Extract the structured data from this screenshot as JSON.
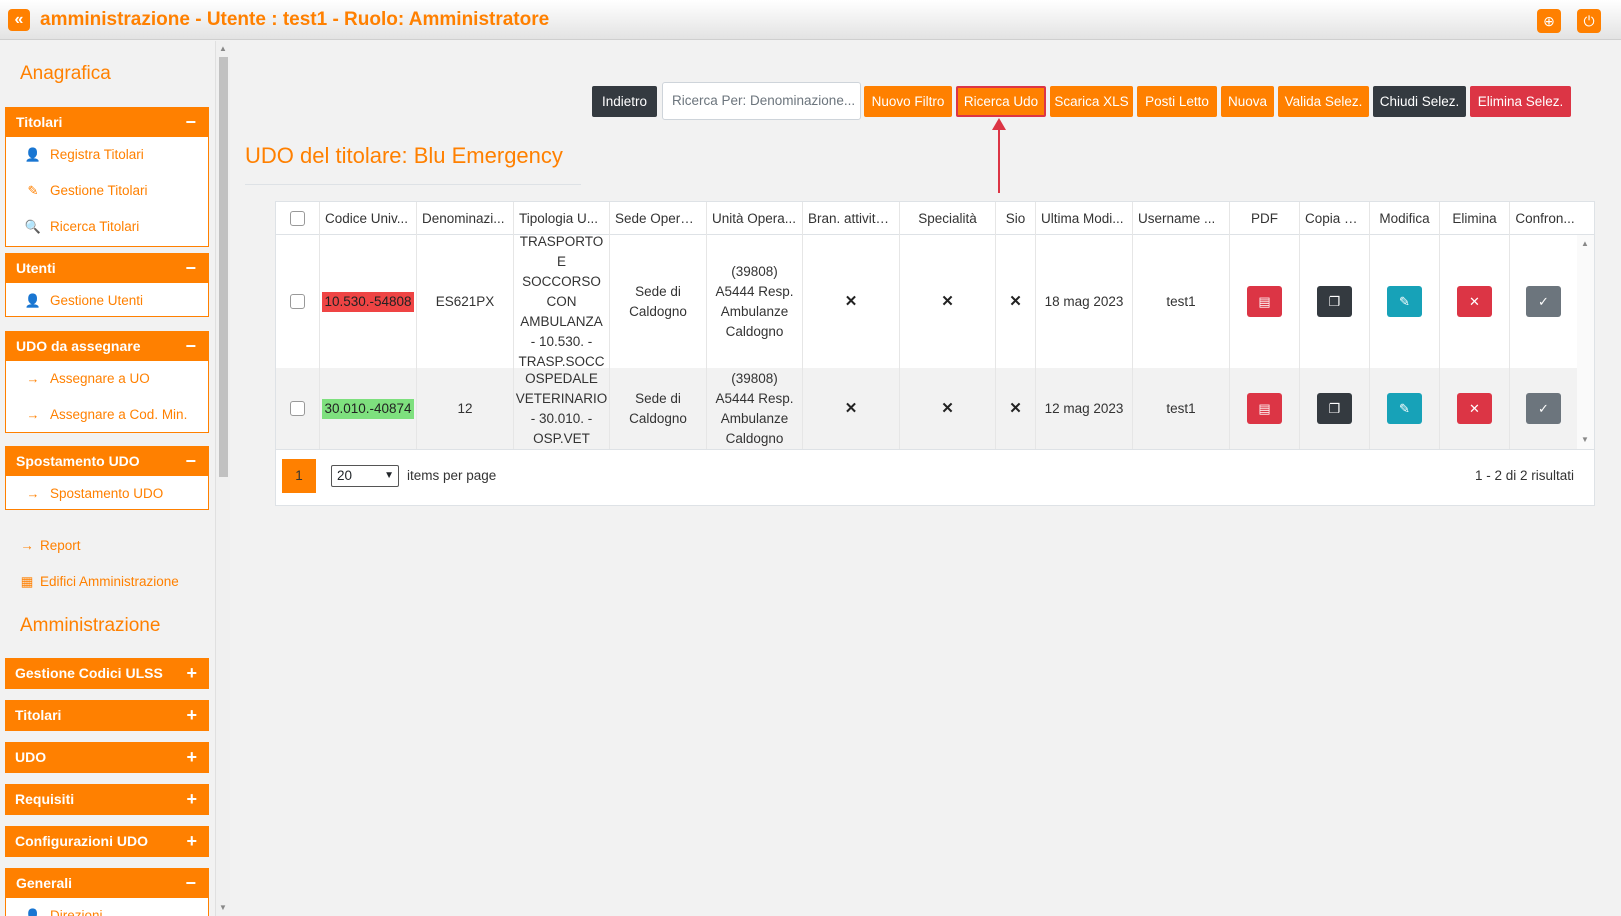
{
  "header": {
    "title": "amministrazione - Utente : test1 - Ruolo: Amministratore",
    "collapse_icon": "«",
    "globe_icon": "⊕",
    "power_icon": "⏻"
  },
  "sidebar": {
    "section_anagrafica": "Anagrafica",
    "titolari": {
      "label": "Titolari",
      "toggle": "−",
      "items": [
        "Registra Titolari",
        "Gestione Titolari",
        "Ricerca Titolari"
      ]
    },
    "utenti": {
      "label": "Utenti",
      "toggle": "−",
      "items": [
        "Gestione Utenti"
      ]
    },
    "udo_da_assegnare": {
      "label": "UDO da assegnare",
      "toggle": "−",
      "items": [
        "Assegnare a UO",
        "Assegnare a Cod. Min."
      ]
    },
    "spostamento_udo": {
      "label": "Spostamento UDO",
      "toggle": "−",
      "items": [
        "Spostamento UDO"
      ]
    },
    "report": "Report",
    "edifici": "Edifici Amministrazione",
    "section_amministrazione": "Amministrazione",
    "collapsed": [
      {
        "label": "Gestione Codici ULSS",
        "toggle": "+"
      },
      {
        "label": "Titolari",
        "toggle": "+"
      },
      {
        "label": "UDO",
        "toggle": "+"
      },
      {
        "label": "Requisiti",
        "toggle": "+"
      },
      {
        "label": "Configurazioni UDO",
        "toggle": "+"
      }
    ],
    "generali": {
      "label": "Generali",
      "toggle": "−",
      "partial_item": "Direzioni"
    }
  },
  "toolbar": {
    "indietro": "Indietro",
    "search_placeholder": "Ricerca Per: Denominazione...",
    "nuovo_filtro": "Nuovo Filtro",
    "ricerca_udo": "Ricerca Udo",
    "scarica_xls": "Scarica XLS",
    "posti_letto": "Posti Letto",
    "nuova": "Nuova",
    "valida_selez": "Valida Selez.",
    "chiudi_selez": "Chiudi Selez.",
    "elimina_selez": "Elimina Selez."
  },
  "main": {
    "title": "UDO del titolare: Blu Emergency"
  },
  "table": {
    "columns": [
      "Codice Univ...",
      "Denominazi...",
      "Tipologia U...",
      "Sede Operat...",
      "Unità Opera...",
      "Bran. attività...",
      "Specialità",
      "Sio",
      "Ultima Modi...",
      "Username ...",
      "PDF",
      "Copia U...",
      "Modifica",
      "Elimina",
      "Confron..."
    ],
    "rows": [
      {
        "code": "10.530.-54808",
        "code_status": "red",
        "denominazione": "ES621PX",
        "tipologia": [
          "TRASPORTO E",
          "SOCCORSO",
          "CON",
          "AMBULANZA",
          "- 10.530. -",
          "TRASP.SOCC"
        ],
        "sede": [
          "Sede di",
          "Caldogno"
        ],
        "unita": [
          "(39808)",
          "A5444 Resp.",
          "Ambulanze",
          "Caldogno"
        ],
        "bran": "✕",
        "specialita": "✕",
        "sio": "✕",
        "ultima_modifica": "18 mag 2023",
        "username": "test1"
      },
      {
        "code": "30.010.-40874",
        "code_status": "green",
        "denominazione": "12",
        "tipologia": [
          "OSPEDALE",
          "VETERINARIO",
          "- 30.010. -",
          "OSP.VET"
        ],
        "sede": [
          "Sede di",
          "Caldogno"
        ],
        "unita": [
          "(39808)",
          "A5444 Resp.",
          "Ambulanze",
          "Caldogno"
        ],
        "bran": "✕",
        "specialita": "✕",
        "sio": "✕",
        "ultima_modifica": "12 mag 2023",
        "username": "test1"
      }
    ]
  },
  "pager": {
    "current_page": "1",
    "page_size": "20",
    "items_per_page": "items per page",
    "results": "1 - 2 di 2 risultati"
  },
  "colors": {
    "accent": "#ff8000",
    "dark": "#343a40",
    "danger": "#dc3545",
    "info": "#17a2b8",
    "secondary": "#6c757d"
  }
}
